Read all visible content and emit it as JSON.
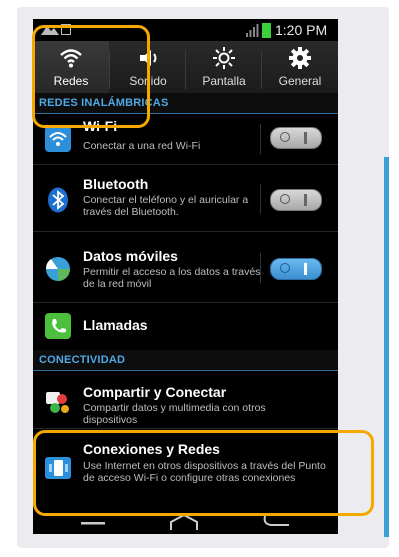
{
  "status_bar": {
    "time": "1:20 PM"
  },
  "tabs": [
    {
      "label": "Redes",
      "icon": "wifi-icon",
      "active": true
    },
    {
      "label": "Sonido",
      "icon": "speaker-icon",
      "active": false
    },
    {
      "label": "Pantalla",
      "icon": "brightness-icon",
      "active": false
    },
    {
      "label": "General",
      "icon": "gear-icon",
      "active": false
    }
  ],
  "sections": {
    "wireless": "REDES INALÁMBRICAS",
    "connectivity": "CONECTIVIDAD"
  },
  "items": {
    "wifi": {
      "title": "Wi-Fi",
      "subtitle": "Conectar a una red Wi-Fi",
      "toggle_on": false
    },
    "bluetooth": {
      "title": "Bluetooth",
      "subtitle": "Conectar el teléfono y el auricular a través del Bluetooth.",
      "toggle_on": false
    },
    "mobile_data": {
      "title": "Datos móviles",
      "subtitle": "Permitir el acceso a los datos a través de la red móvil",
      "toggle_on": true
    },
    "calls": {
      "title": "Llamadas"
    },
    "share": {
      "title": "Compartir y Conectar",
      "subtitle": "Compartir datos y multimedia con otros dispositivos"
    },
    "connections": {
      "title": "Conexiones y Redes",
      "subtitle": "Use Internet en otros dispositivos a través del Punto de acceso Wi-Fi o configure otras conexiones"
    }
  },
  "colors": {
    "accent": "#3b9fd8",
    "highlight": "#f5a800",
    "toggle_on": "#3b8fd1"
  }
}
